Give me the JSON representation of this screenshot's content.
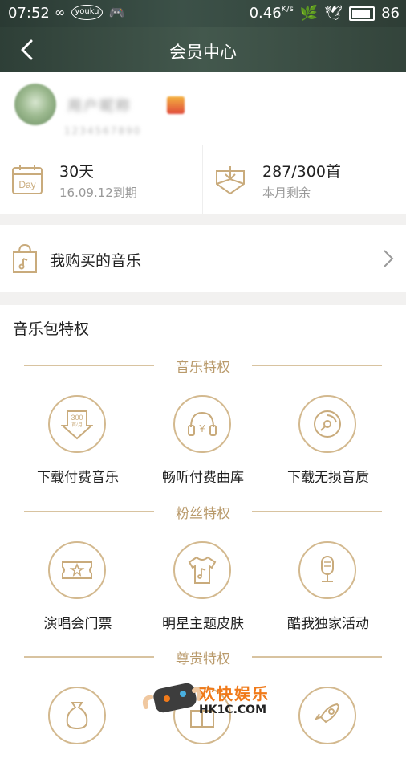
{
  "status_bar": {
    "time": "07:52",
    "net_speed": "0.46",
    "net_unit": "K/s",
    "battery": "86",
    "icons": [
      "infinity-icon",
      "youku-icon",
      "gamepad-icon",
      "leaf-icon",
      "bird-icon",
      "battery-icon"
    ],
    "youku_text": "youku"
  },
  "header": {
    "title": "会员中心",
    "back_icon": "chevron-left-icon"
  },
  "profile": {
    "username": "用户昵称",
    "user_id": "1234567890"
  },
  "stats": [
    {
      "icon": "calendar-day-icon",
      "icon_text": "Day",
      "value": "30天",
      "sub": "16.09.12到期"
    },
    {
      "icon": "download-box-icon",
      "value": "287/300首",
      "sub": "本月剩余"
    }
  ],
  "purchased": {
    "label": "我购买的音乐",
    "icon": "shopping-bag-icon"
  },
  "package": {
    "title": "音乐包特权",
    "sections": [
      {
        "title": "音乐特权",
        "items": [
          {
            "label": "下载付费音乐",
            "icon": "download-300-icon",
            "icon_text": "300",
            "icon_subtext": "首/月"
          },
          {
            "label": "畅听付费曲库",
            "icon": "headphones-yen-icon",
            "icon_text": "¥"
          },
          {
            "label": "下载无损音质",
            "icon": "disc-icon"
          }
        ]
      },
      {
        "title": "粉丝特权",
        "items": [
          {
            "label": "演唱会门票",
            "icon": "ticket-star-icon"
          },
          {
            "label": "明星主题皮肤",
            "icon": "tshirt-icon"
          },
          {
            "label": "酷我独家活动",
            "icon": "microphone-icon"
          }
        ]
      },
      {
        "title": "尊贵特权",
        "items": [
          {
            "label": "",
            "icon": "money-bag-icon"
          },
          {
            "label": "",
            "icon": "gift-icon"
          },
          {
            "label": "",
            "icon": "rocket-icon"
          }
        ]
      }
    ]
  },
  "watermark": {
    "text": "欢快娱乐",
    "url": "HK1C.COM"
  },
  "colors": {
    "accent": "#b99a6b",
    "divider": "#d8c3a0",
    "header_bg": "#3c5148",
    "page_gap": "#f2f1f0"
  }
}
